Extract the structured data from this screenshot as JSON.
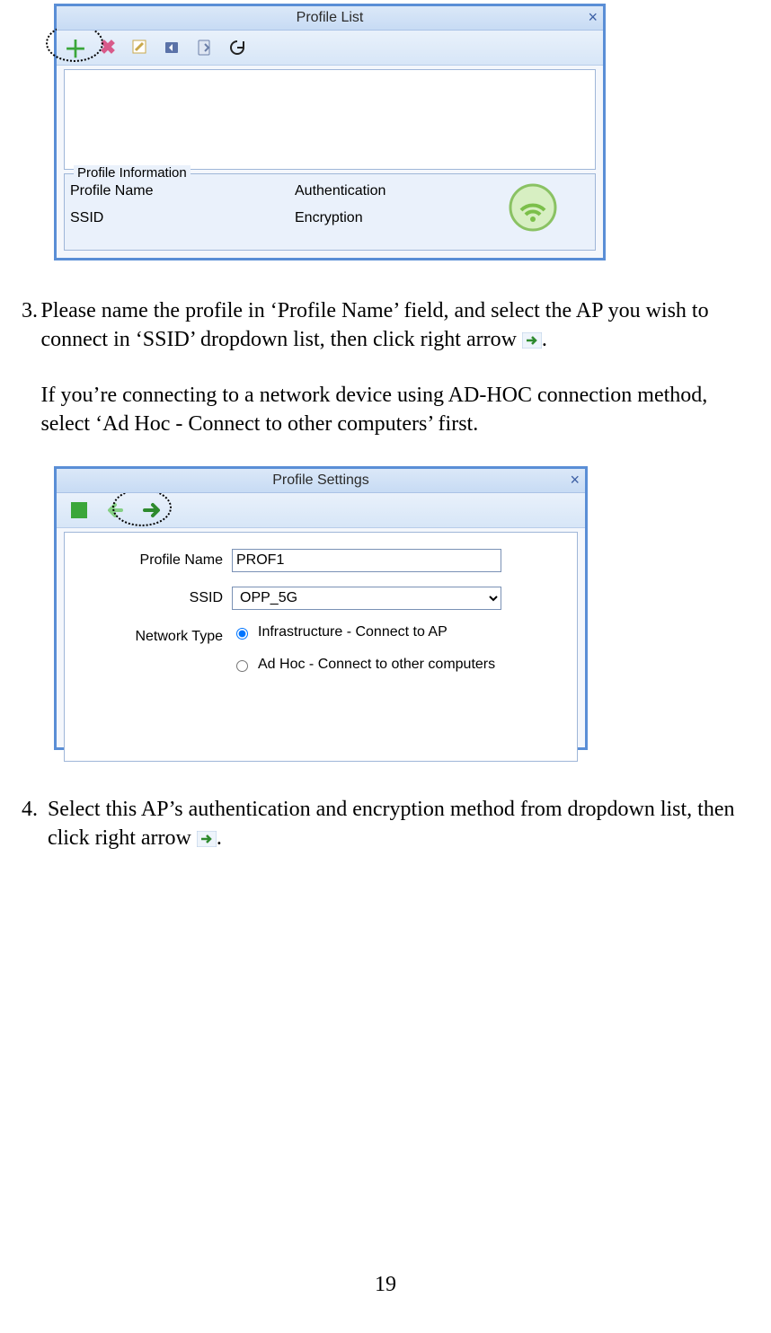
{
  "page_number": "19",
  "window1": {
    "title": "Profile List",
    "fieldset": "Profile Information",
    "labels": {
      "profile_name": "Profile Name",
      "ssid": "SSID",
      "authentication": "Authentication",
      "encryption": "Encryption"
    }
  },
  "step3": {
    "num": "3.",
    "para1a": "Please name the profile in ‘Profile Name’ field, and select the AP you wish to connect in ‘SSID’ dropdown list, then click right arrow  ",
    "para1b": ".",
    "para2": "If you’re connecting to a network device using AD-HOC connection method, select ‘Ad Hoc - Connect to other computers’ first."
  },
  "window2": {
    "title": "Profile Settings",
    "labels": {
      "profile_name": "Profile Name",
      "ssid": "SSID",
      "network_type": "Network Type"
    },
    "values": {
      "profile_name": "PROF1",
      "ssid": "OPP_5G"
    },
    "radio": {
      "infra": "Infrastructure - Connect to AP",
      "adhoc": "Ad Hoc - Connect to other computers"
    }
  },
  "step4": {
    "num": "4.",
    "para_a": "Select this AP’s authentication and encryption method from dropdown list, then click right arrow  ",
    "para_b": "."
  }
}
